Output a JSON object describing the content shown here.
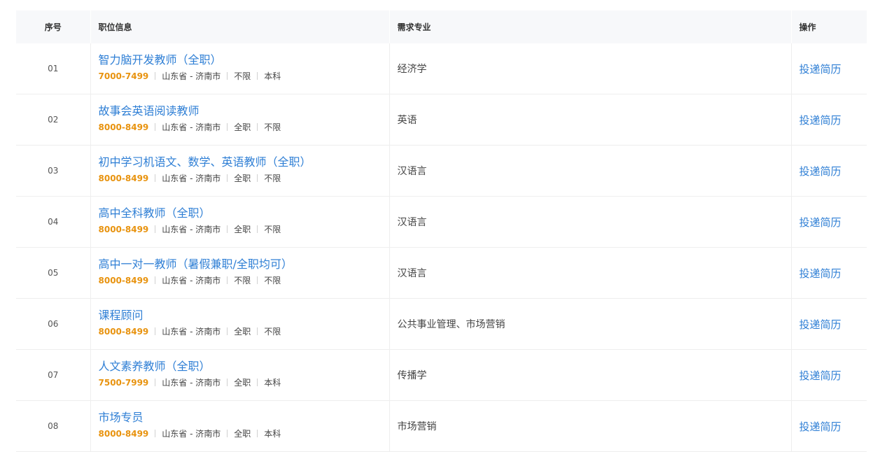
{
  "header": {
    "no": "序号",
    "info": "职位信息",
    "major": "需求专业",
    "op": "操作"
  },
  "rows": [
    {
      "no": "01",
      "title": "智力脑开发教师（全职）",
      "salary": "7000-7499",
      "location": "山东省 - 济南市",
      "type": "不限",
      "edu": "本科",
      "major": "经济学",
      "action": "投递简历"
    },
    {
      "no": "02",
      "title": "故事会英语阅读教师",
      "salary": "8000-8499",
      "location": "山东省 - 济南市",
      "type": "全职",
      "edu": "不限",
      "major": "英语",
      "action": "投递简历"
    },
    {
      "no": "03",
      "title": "初中学习机语文、数学、英语教师（全职）",
      "salary": "8000-8499",
      "location": "山东省 - 济南市",
      "type": "全职",
      "edu": "不限",
      "major": "汉语言",
      "action": "投递简历"
    },
    {
      "no": "04",
      "title": "高中全科教师（全职）",
      "salary": "8000-8499",
      "location": "山东省 - 济南市",
      "type": "全职",
      "edu": "不限",
      "major": "汉语言",
      "action": "投递简历"
    },
    {
      "no": "05",
      "title": "高中一对一教师（暑假兼职/全职均可）",
      "salary": "8000-8499",
      "location": "山东省 - 济南市",
      "type": "不限",
      "edu": "不限",
      "major": "汉语言",
      "action": "投递简历"
    },
    {
      "no": "06",
      "title": "课程顾问",
      "salary": "8000-8499",
      "location": "山东省 - 济南市",
      "type": "全职",
      "edu": "不限",
      "major": "公共事业管理、市场营销",
      "action": "投递简历"
    },
    {
      "no": "07",
      "title": "人文素养教师（全职）",
      "salary": "7500-7999",
      "location": "山东省 - 济南市",
      "type": "全职",
      "edu": "本科",
      "major": "传播学",
      "action": "投递简历"
    },
    {
      "no": "08",
      "title": "市场专员",
      "salary": "8000-8499",
      "location": "山东省 - 济南市",
      "type": "全职",
      "edu": "本科",
      "major": "市场营销",
      "action": "投递简历"
    }
  ]
}
